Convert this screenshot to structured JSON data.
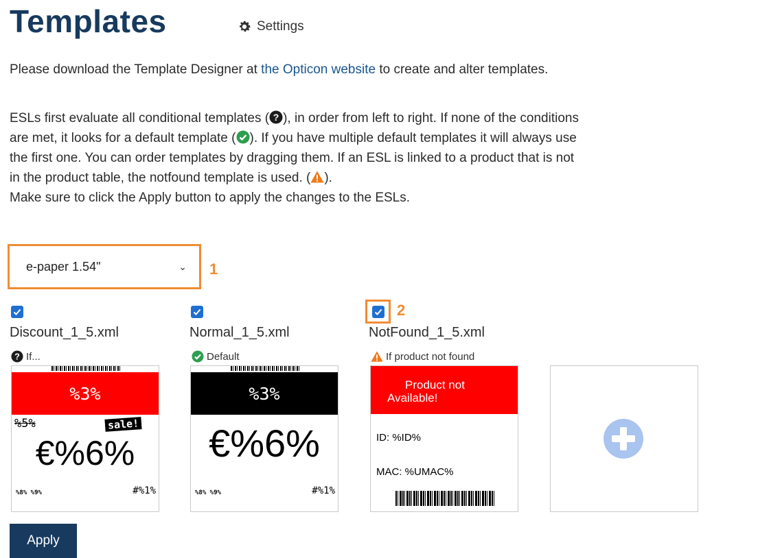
{
  "header": {
    "title": "Templates",
    "settings_label": "Settings"
  },
  "intro": {
    "line1_pre": "Please download the Template Designer at ",
    "line1_link": "the Opticon website",
    "line1_post": " to create and alter templates.",
    "p2_l1_a": "ESLs first evaluate all conditional templates (",
    "p2_l1_b": "), in order from left to right. If none of the conditions",
    "p2_l2_a": "are met, it looks for a default template (",
    "p2_l2_b": "). If you have multiple default templates it will always use",
    "p2_l3": "the first one. You can order templates by dragging them. If an ESL is linked to a product that is not",
    "p2_l4_a": "in the product table, the notfound template is used. (",
    "p2_l4_b": ").",
    "p2_l5": "Make sure to click the Apply button to apply the changes to the ESLs."
  },
  "display_select": {
    "value": "e-paper 1.54\"",
    "marker": "1"
  },
  "checkbox_marker": "2",
  "templates": [
    {
      "filename": "Discount_1_5.xml",
      "checked": true,
      "status": "If...",
      "band_text": "%3%",
      "band_color": "#ff0000",
      "old_price": "%5%",
      "badge": "sale!",
      "price": "€%6%",
      "foot_left": "%8% %9%",
      "foot_right": "#%1%"
    },
    {
      "filename": "Normal_1_5.xml",
      "checked": true,
      "status": "Default",
      "band_text": "%3%",
      "band_color": "#000000",
      "price": "€%6%",
      "foot_left": "%8% %9%",
      "foot_right": "#%1%"
    },
    {
      "filename": "NotFound_1_5.xml",
      "checked": true,
      "status": "If product not found",
      "band_line1": "Product not",
      "band_line2": "Available!",
      "band_color": "#ff0000",
      "id_line": "ID: %ID%",
      "mac_line": "MAC: %UMAC%"
    }
  ],
  "apply_label": "Apply",
  "colors": {
    "navy": "#173a5e",
    "accent_orange": "#f08c33",
    "check_blue": "#1f6fd1",
    "ok_green": "#2e9e4f",
    "warn_orange": "#f07a1a",
    "add_blue": "#a9c4ee"
  },
  "icons": [
    "gear-icon",
    "question-circle-icon",
    "check-circle-icon",
    "warning-triangle-icon",
    "plus-circle-icon",
    "chevron-down-icon",
    "checkbox-check-icon"
  ]
}
